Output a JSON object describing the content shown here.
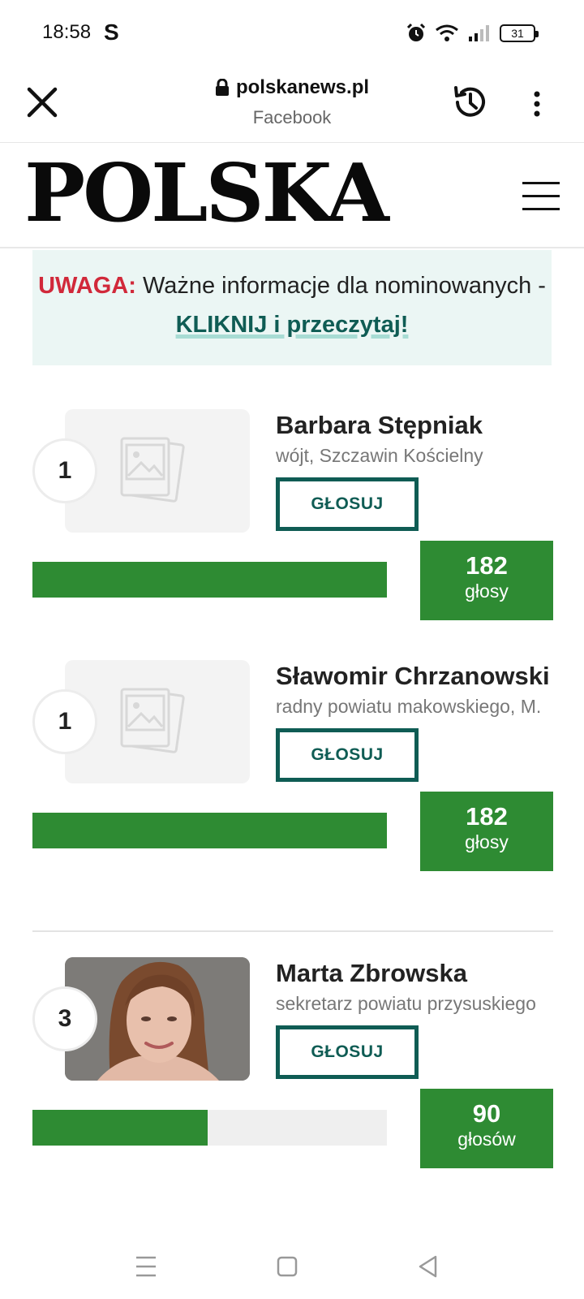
{
  "status_bar": {
    "time": "18:58",
    "app_letter": "S",
    "battery": "31"
  },
  "browser": {
    "domain": "polskanews.pl",
    "source": "Facebook",
    "icons": [
      "close-icon",
      "lock-icon",
      "history-icon",
      "more-vert-icon"
    ]
  },
  "site": {
    "logo": "POLSKA",
    "menu_icon": "hamburger-icon"
  },
  "notice": {
    "warning": "UWAGA:",
    "text": " Ważne informacje dla nominowanych - ",
    "link": "KLIKNIJ i przeczytaj!"
  },
  "candidates": [
    {
      "rank": "1",
      "name": "Barbara Stępniak",
      "role": "wójt, Szczawin Kościelny",
      "button": "GŁOSUJ",
      "votes": "182",
      "votes_label": "głosy",
      "bar_fraction": 1.0,
      "photo": "placeholder"
    },
    {
      "rank": "1",
      "name": "Sławomir Chrzanowski",
      "role": "radny powiatu makowskiego, M.",
      "button": "GŁOSUJ",
      "votes": "182",
      "votes_label": "głosy",
      "bar_fraction": 1.0,
      "photo": "placeholder"
    },
    {
      "rank": "3",
      "name": "Marta Zbrowska",
      "role": "sekretarz powiatu przysuskiego",
      "button": "GŁOSUJ",
      "votes": "90",
      "votes_label": "głosów",
      "bar_fraction": 0.495,
      "photo": "portrait"
    }
  ],
  "colors": {
    "accent_green": "#2e8b33",
    "button_teal": "#0f5c54",
    "warning_red": "#d1293a",
    "notice_bg": "#ebf6f4"
  },
  "nav": {
    "icons": [
      "recent-apps-icon",
      "home-icon",
      "back-icon"
    ]
  }
}
